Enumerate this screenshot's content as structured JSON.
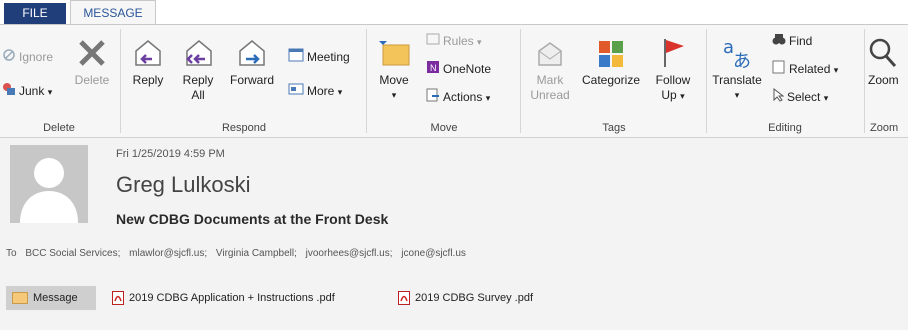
{
  "tabs": {
    "file": "FILE",
    "message": "MESSAGE"
  },
  "ribbon": {
    "delete_group": {
      "ignore": "Ignore",
      "junk": "Junk",
      "delete": "Delete",
      "label": "Delete"
    },
    "respond_group": {
      "reply": "Reply",
      "reply_all_1": "Reply",
      "reply_all_2": "All",
      "forward": "Forward",
      "meeting": "Meeting",
      "more": "More",
      "label": "Respond"
    },
    "move_group": {
      "move": "Move",
      "rules": "Rules",
      "onenote": "OneNote",
      "actions": "Actions",
      "label": "Move"
    },
    "tags_group": {
      "mark_unread_1": "Mark",
      "mark_unread_2": "Unread",
      "categorize": "Categorize",
      "follow_up_1": "Follow",
      "follow_up_2": "Up",
      "label": "Tags"
    },
    "editing_group": {
      "translate": "Translate",
      "find": "Find",
      "related": "Related",
      "select": "Select",
      "label": "Editing"
    },
    "zoom_group": {
      "zoom": "Zoom",
      "label": "Zoom"
    }
  },
  "message": {
    "date": "Fri 1/25/2019 4:59 PM",
    "sender": "Greg Lulkoski",
    "subject": "New CDBG Documents at the Front Desk",
    "to_label": "To",
    "recipients": [
      "BCC Social Services;",
      "mlawlor@sjcfl.us;",
      "Virginia Campbell;",
      "jvoorhees@sjcfl.us;",
      "jcone@sjcfl.us"
    ]
  },
  "attachments": {
    "message_tab": "Message",
    "files": [
      "2019 CDBG Application + Instructions .pdf",
      "2019 CDBG Survey  .pdf"
    ]
  }
}
